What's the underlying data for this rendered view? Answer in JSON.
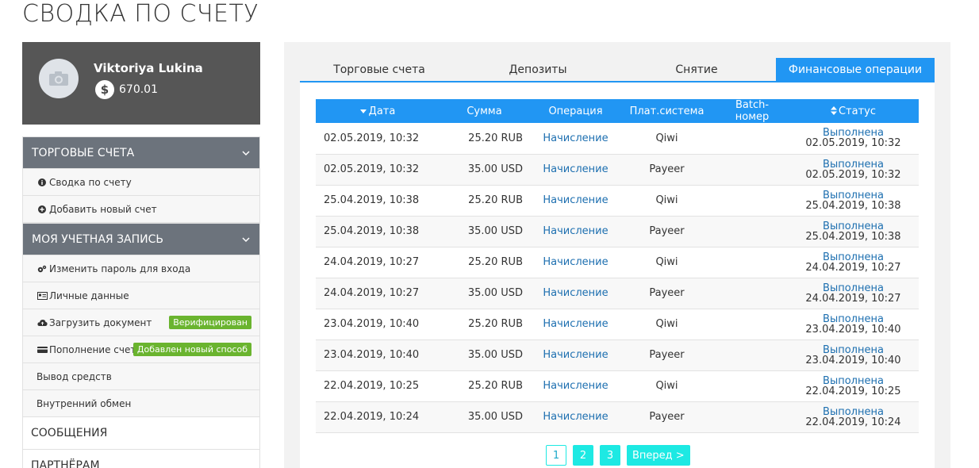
{
  "page": {
    "title": "СВОДКА ПО СЧЕТУ"
  },
  "profile": {
    "name": "Viktoriya Lukina",
    "currency_symbol": "$",
    "balance": "670.01"
  },
  "sidebar": {
    "section_trading": "ТОРГОВЫЕ СЧЕТА",
    "summary": "Сводка по счету",
    "add_account": "Добавить новый счет",
    "section_account": "МОЯ УЧЕТНАЯ ЗАПИСЬ",
    "change_password": "Изменить пароль для входа",
    "personal_data": "Личные данные",
    "upload_document": "Загрузить документ",
    "upload_badge": "Верифицирован",
    "deposit": "Пополнение счета",
    "deposit_badge": "Добавлен новый способ",
    "withdrawal": "Вывод средств",
    "internal_exchange": "Внутренний обмен",
    "messages": "СООБЩЕНИЯ",
    "partners": "ПАРТНЁРАМ"
  },
  "tabs": {
    "trading_accounts": "Торговые счета",
    "deposits": "Депозиты",
    "withdrawals": "Снятие",
    "financial_operations": "Финансовые операции"
  },
  "table": {
    "headers": {
      "date": "Дата",
      "sum": "Сумма",
      "operation": "Операция",
      "payment_system": "Плат.система",
      "batch": "Batch-номер",
      "status": "Статус"
    },
    "rows": [
      {
        "date": "02.05.2019, 10:32",
        "sum": "25.20 RUB",
        "operation": "Начисление",
        "system": "Qiwi",
        "batch": "",
        "status": "Выполнена",
        "status_date": "02.05.2019, 10:32"
      },
      {
        "date": "02.05.2019, 10:32",
        "sum": "35.00 USD",
        "operation": "Начисление",
        "system": "Payeer",
        "batch": "",
        "status": "Выполнена",
        "status_date": "02.05.2019, 10:32"
      },
      {
        "date": "25.04.2019, 10:38",
        "sum": "25.20 RUB",
        "operation": "Начисление",
        "system": "Qiwi",
        "batch": "",
        "status": "Выполнена",
        "status_date": "25.04.2019, 10:38"
      },
      {
        "date": "25.04.2019, 10:38",
        "sum": "35.00 USD",
        "operation": "Начисление",
        "system": "Payeer",
        "batch": "",
        "status": "Выполнена",
        "status_date": "25.04.2019, 10:38"
      },
      {
        "date": "24.04.2019, 10:27",
        "sum": "25.20 RUB",
        "operation": "Начисление",
        "system": "Qiwi",
        "batch": "",
        "status": "Выполнена",
        "status_date": "24.04.2019, 10:27"
      },
      {
        "date": "24.04.2019, 10:27",
        "sum": "35.00 USD",
        "operation": "Начисление",
        "system": "Payeer",
        "batch": "",
        "status": "Выполнена",
        "status_date": "24.04.2019, 10:27"
      },
      {
        "date": "23.04.2019, 10:40",
        "sum": "25.20 RUB",
        "operation": "Начисление",
        "system": "Qiwi",
        "batch": "",
        "status": "Выполнена",
        "status_date": "23.04.2019, 10:40"
      },
      {
        "date": "23.04.2019, 10:40",
        "sum": "35.00 USD",
        "operation": "Начисление",
        "system": "Payeer",
        "batch": "",
        "status": "Выполнена",
        "status_date": "23.04.2019, 10:40"
      },
      {
        "date": "22.04.2019, 10:25",
        "sum": "25.20 RUB",
        "operation": "Начисление",
        "system": "Qiwi",
        "batch": "",
        "status": "Выполнена",
        "status_date": "22.04.2019, 10:25"
      },
      {
        "date": "22.04.2019, 10:24",
        "sum": "35.00 USD",
        "operation": "Начисление",
        "system": "Payeer",
        "batch": "",
        "status": "Выполнена",
        "status_date": "22.04.2019, 10:24"
      }
    ]
  },
  "pagination": {
    "pages": [
      "1",
      "2",
      "3"
    ],
    "current": "1",
    "next_label": "Вперед >"
  },
  "colors": {
    "accent": "#2196f3",
    "sidebar_section": "#6c737c",
    "badge_green": "#6ab42f",
    "pager_cyan": "#1de9e3",
    "link": "#1d6fb0"
  }
}
